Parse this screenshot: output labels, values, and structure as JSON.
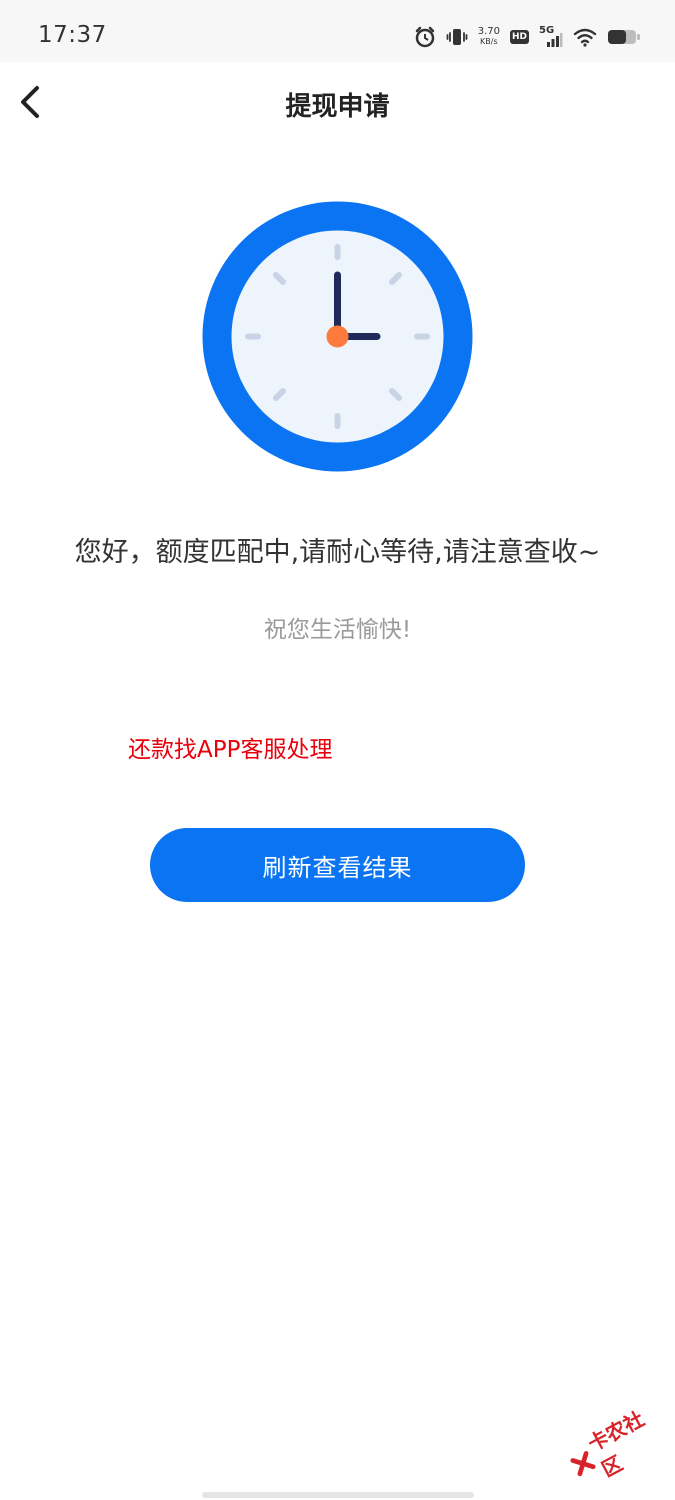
{
  "status_bar": {
    "time": "17:37",
    "net_speed_value": "3.70",
    "net_speed_unit": "KB/s",
    "hd_label": "HD",
    "network_label": "5G",
    "icons": [
      "alarm-icon",
      "vibrate-icon",
      "hd-icon",
      "signal-5g-icon",
      "wifi-icon",
      "battery-icon"
    ]
  },
  "nav": {
    "title": "提现申请",
    "back_icon": "chevron-left-icon"
  },
  "main": {
    "illustration": "clock-icon",
    "message": "您好，额度匹配中,请耐心等待,请注意查收~",
    "wish": "祝您生活愉快!",
    "note": "还款找APP客服处理",
    "refresh_label": "刷新查看结果"
  },
  "watermark": {
    "text": "卡农社区"
  },
  "colors": {
    "primary": "#0a74f2",
    "clock_face": "#eef4fb",
    "clock_hands": "#1f2a5a",
    "clock_center": "#ff7a3d",
    "note_red": "#e8000b"
  }
}
